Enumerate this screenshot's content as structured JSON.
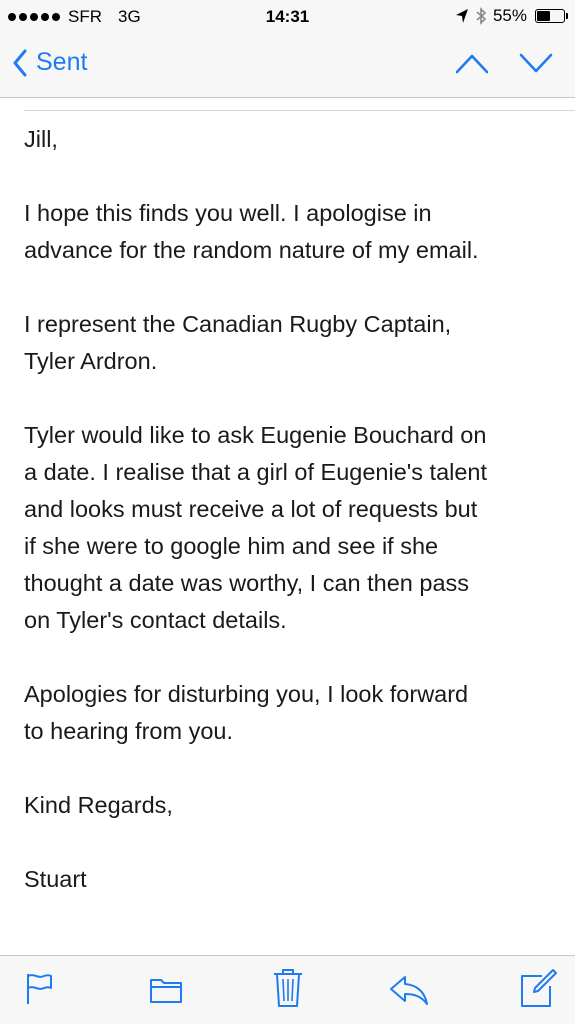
{
  "status_bar": {
    "carrier": "SFR",
    "network": "3G",
    "time": "14:31",
    "battery_percent": "55%",
    "battery_level": 0.55
  },
  "nav": {
    "back_label": "Sent",
    "accent_color": "#1f7cf0"
  },
  "email": {
    "greeting": "Jill,",
    "paragraph_1": "I hope this finds you well.  I apologise in\nadvance for the random nature of my email.",
    "paragraph_2": "I represent the Canadian Rugby Captain,\nTyler Ardron.",
    "paragraph_3": "Tyler would like to ask Eugenie Bouchard on\na date.  I realise that a girl of Eugenie's talent\nand looks must receive a lot of requests but\nif she were to google him and see if she\nthought a date was worthy, I can then pass\non Tyler's contact details.",
    "paragraph_4": "Apologies for disturbing you, I look forward\nto hearing from you.",
    "sign_off": "Kind Regards,",
    "signature": "Stuart"
  },
  "toolbar": {
    "icons": [
      "flag-icon",
      "folder-icon",
      "trash-icon",
      "reply-icon",
      "compose-icon"
    ]
  }
}
